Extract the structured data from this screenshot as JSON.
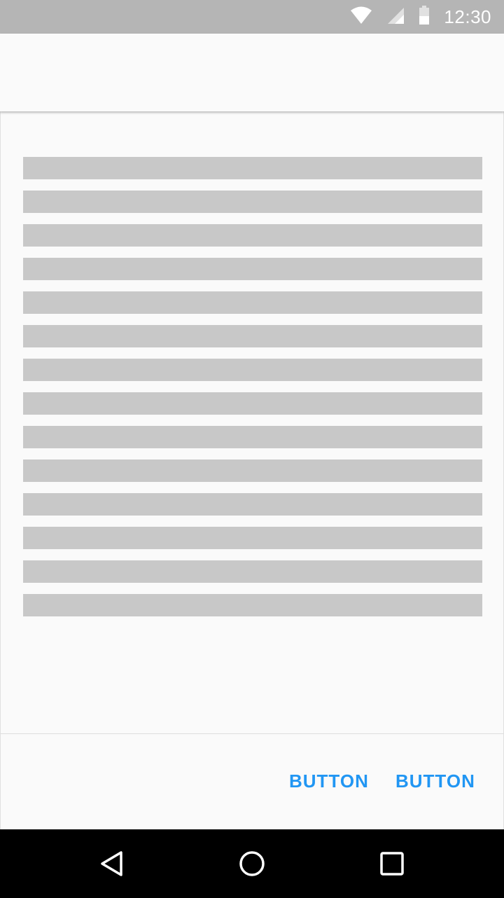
{
  "status_bar": {
    "time": "12:30",
    "icons": [
      "wifi-icon",
      "cellular-signal-icon",
      "battery-icon"
    ],
    "color": "#b5b5b5"
  },
  "content": {
    "placeholder_line_count": 14,
    "placeholder_color": "#c8c8c8"
  },
  "actions": {
    "button1_label": "BUTTON",
    "button2_label": "BUTTON",
    "accent_color": "#2196f3"
  },
  "nav_bar": {
    "items": [
      "back-icon",
      "home-icon",
      "recents-icon"
    ]
  }
}
